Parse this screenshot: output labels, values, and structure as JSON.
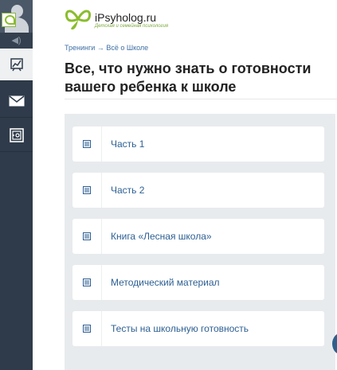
{
  "site": {
    "name": "iPsyholog.ru",
    "tagline": "Детская и семейная психология"
  },
  "breadcrumb": {
    "parent": "Тренинги",
    "separator": "→",
    "current": "Всё о Школе"
  },
  "page": {
    "title": "Все, что нужно знать о готовности вашего ребенка к школе"
  },
  "lessons": [
    {
      "label": "Часть 1",
      "icon": "document-icon"
    },
    {
      "label": "Часть 2",
      "icon": "document-icon"
    },
    {
      "label": "Книга «Лесная школа»",
      "icon": "document-icon"
    },
    {
      "label": "Методический материал",
      "icon": "document-icon"
    },
    {
      "label": "Тесты на школьную готовность",
      "icon": "document-icon"
    }
  ],
  "sidebar": {
    "items": [
      "chart-icon",
      "mail-icon",
      "safe-icon"
    ],
    "active": "chart-icon"
  },
  "colors": {
    "sidebar": "#2f3b4a",
    "link": "#2d5f93",
    "panel": "#e8ebee",
    "brand_green": "#8bbd2c"
  }
}
